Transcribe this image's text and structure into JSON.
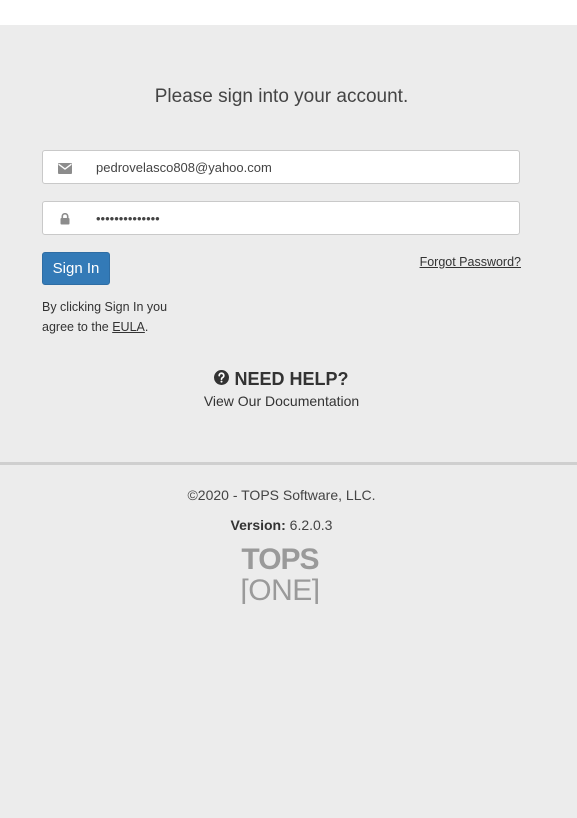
{
  "header": {
    "prompt": "Please sign into your account."
  },
  "form": {
    "email": {
      "value": "pedrovelasco808@yahoo.com",
      "icon": "envelope-icon"
    },
    "password": {
      "value": "••••••••••••••",
      "icon": "lock-icon"
    },
    "signin_label": "Sign In",
    "forgot_label": "Forgot Password?",
    "eula_prefix": "By clicking Sign In you agree to the ",
    "eula_link": "EULA",
    "eula_suffix": "."
  },
  "help": {
    "title": "NEED HELP?",
    "icon": "question-circle-icon",
    "doc_link": "View Our Documentation"
  },
  "footer": {
    "copyright": "©2020 - TOPS Software, LLC.",
    "version_label": "Version:",
    "version_value": "6.2.0.3",
    "logo_top": "TOPS",
    "logo_bottom": "[ONE]"
  },
  "colors": {
    "primary": "#337ab7",
    "background": "#ececec",
    "logo_gray": "#9a9a9a"
  }
}
